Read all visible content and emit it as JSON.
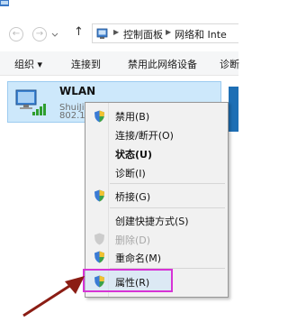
{
  "addressbar": {
    "up_glyph": "↑",
    "back_glyph": "←",
    "forward_glyph": "→",
    "crumbs": [
      "控制面板",
      "网络和 Inte"
    ]
  },
  "toolbar": {
    "organize": "组织 ▾",
    "connect": "连接到",
    "disable": "禁用此网络设备",
    "diagnose": "诊断"
  },
  "adapter": {
    "name": "WLAN",
    "sub1": "ShuiJi... 共享的",
    "sub2": "802.1..."
  },
  "menu": {
    "disable": "禁用(B)",
    "connect_disconnect": "连接/断开(O)",
    "status": "状态(U)",
    "diagnose": "诊断(I)",
    "bridge": "桥接(G)",
    "shortcut": "创建快捷方式(S)",
    "delete": "删除(D)",
    "rename": "重命名(M)",
    "properties": "属性(R)"
  },
  "colors": {
    "highlight_border": "#d733d5",
    "arrow": "#8b1d14",
    "selection": "#cde8fb"
  }
}
